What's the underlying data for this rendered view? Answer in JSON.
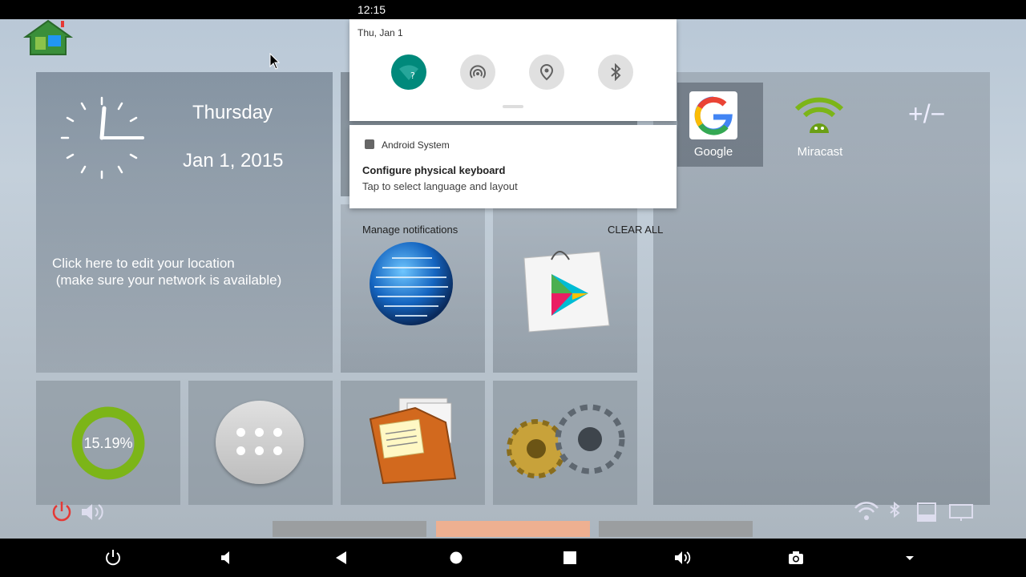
{
  "status_bar": {
    "time": "12:15"
  },
  "clock_widget": {
    "day": "Thursday",
    "date": "Jan 1, 2015",
    "location_hint": "Click here to edit your location\n (make sure your network is available)"
  },
  "memory_widget": {
    "percent": "15.19%"
  },
  "apps": {
    "google_label": "Google",
    "miracast_label": "Miracast",
    "add_remove_label": "+/−"
  },
  "quick_settings": {
    "date": "Thu, Jan 1",
    "tiles": [
      {
        "name": "wifi-icon",
        "active": true
      },
      {
        "name": "hotspot-icon",
        "active": false
      },
      {
        "name": "location-icon",
        "active": false
      },
      {
        "name": "bluetooth-icon",
        "active": false
      }
    ]
  },
  "notification": {
    "app_name": "Android System",
    "title": "Configure physical keyboard",
    "text": "Tap to select language and layout"
  },
  "shade_actions": {
    "manage": "Manage notifications",
    "clear_all": "CLEAR ALL"
  },
  "colors": {
    "accent_teal": "#00897b",
    "memory_ring": "#7cb518",
    "progress_highlight": "#f5af8c"
  }
}
